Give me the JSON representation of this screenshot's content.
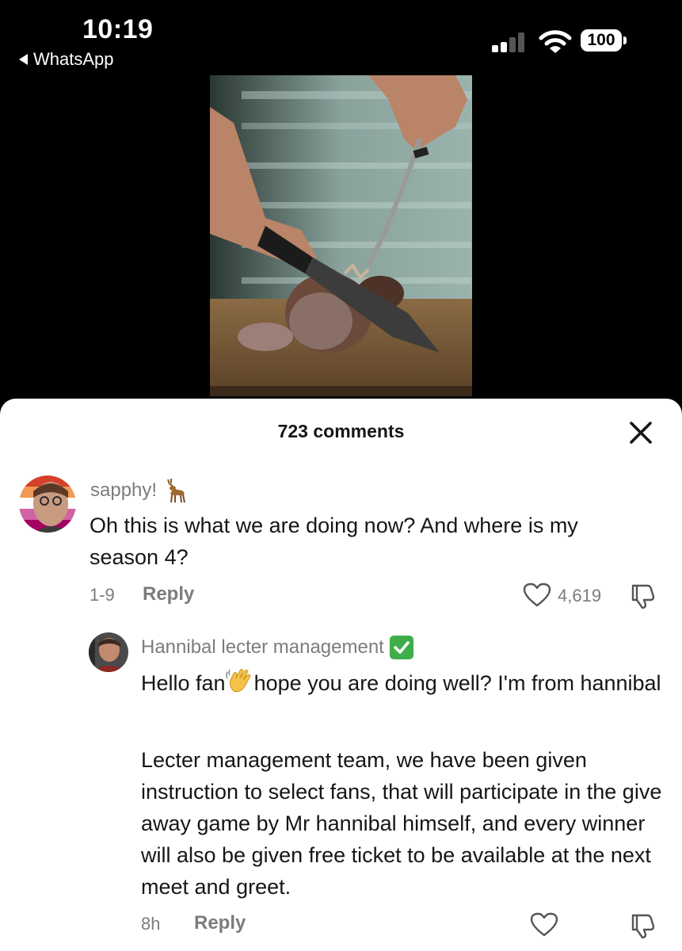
{
  "status_bar": {
    "time": "10:19",
    "back_app": "WhatsApp",
    "battery": "100",
    "icons": [
      "signal-icon",
      "wifi-icon",
      "battery-icon"
    ]
  },
  "sheet": {
    "title": "723 comments",
    "close_icon": "close-icon"
  },
  "comments": [
    {
      "username": "sapphy!",
      "username_emoji": "deer-icon",
      "text": "Oh this is what we are doing now? And where is my season 4?",
      "date": "1-9",
      "reply_label": "Reply",
      "likes": "4,619"
    },
    {
      "username": "Hannibal lecter management",
      "username_emoji": "check-mark-icon",
      "text_part1": "Hello fan",
      "text_emoji": "waving-hand-icon",
      "text_part2": "hope you are doing well? I'm from hannibal",
      "paragraph2": "Lecter management team, we have been given instruction to select fans, that will participate in the give away game by Mr hannibal himself, and every winner will also be given free ticket to be available at the next meet and greet.",
      "date": "8h",
      "reply_label": "Reply"
    }
  ],
  "colors": {
    "background": "#000000",
    "sheet": "#ffffff",
    "muted_text": "#7c7c7c",
    "primary_text": "#161616",
    "verified_green": "#3fae4a"
  }
}
